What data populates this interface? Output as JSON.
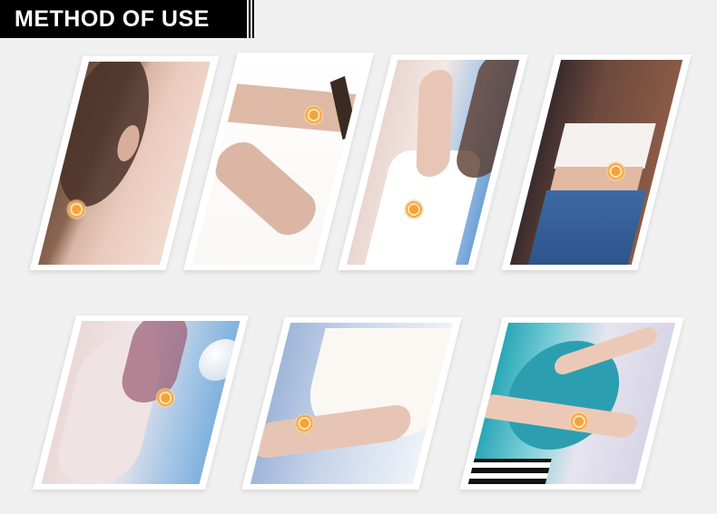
{
  "header": {
    "title": "METHOD OF USE"
  },
  "steps": [
    {
      "label": "behind-ear",
      "icon": "acupoint-marker-icon"
    },
    {
      "label": "inner-arm",
      "icon": "acupoint-marker-icon"
    },
    {
      "label": "upper-arm",
      "icon": "acupoint-marker-icon"
    },
    {
      "label": "abdomen",
      "icon": "acupoint-marker-icon"
    },
    {
      "label": "thigh",
      "icon": "acupoint-marker-icon"
    },
    {
      "label": "knee",
      "icon": "acupoint-marker-icon"
    },
    {
      "label": "calf",
      "icon": "acupoint-marker-icon"
    }
  ],
  "colors": {
    "banner": "#000000",
    "marker": "#f2a33a",
    "background": "#f0f0f0"
  }
}
